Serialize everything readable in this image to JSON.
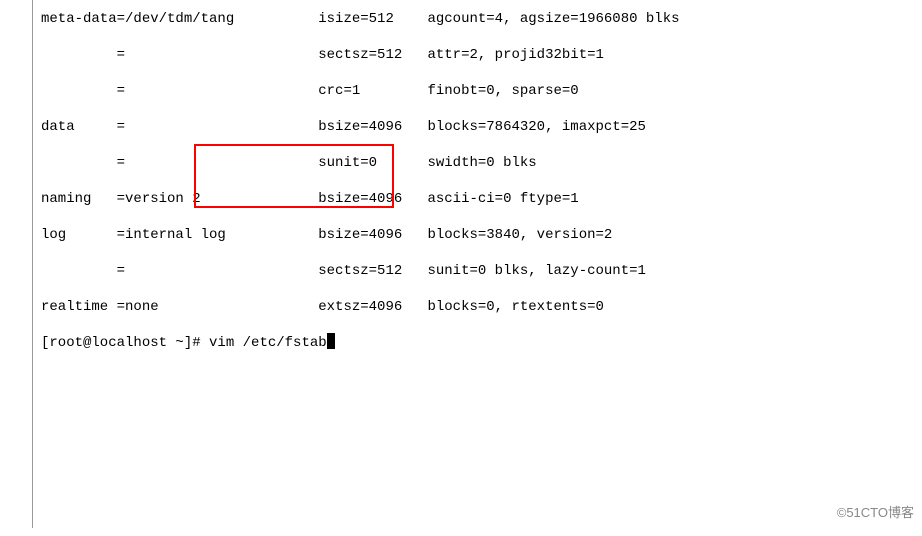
{
  "terminal": {
    "lines": [
      "meta-data=/dev/tdm/tang          isize=512    agcount=4, agsize=1966080 blks",
      "         =                       sectsz=512   attr=2, projid32bit=1",
      "         =                       crc=1        finobt=0, sparse=0",
      "data     =                       bsize=4096   blocks=7864320, imaxpct=25",
      "         =                       sunit=0      swidth=0 blks",
      "naming   =version 2              bsize=4096   ascii-ci=0 ftype=1",
      "log      =internal log           bsize=4096   blocks=3840, version=2",
      "         =                       sectsz=512   sunit=0 blks, lazy-count=1",
      "realtime =none                   extsz=4096   blocks=0, rtextents=0"
    ],
    "prompt": "[root@localhost ~]# ",
    "command": "vim /etc/fstab"
  },
  "watermark": "©51CTO博客"
}
